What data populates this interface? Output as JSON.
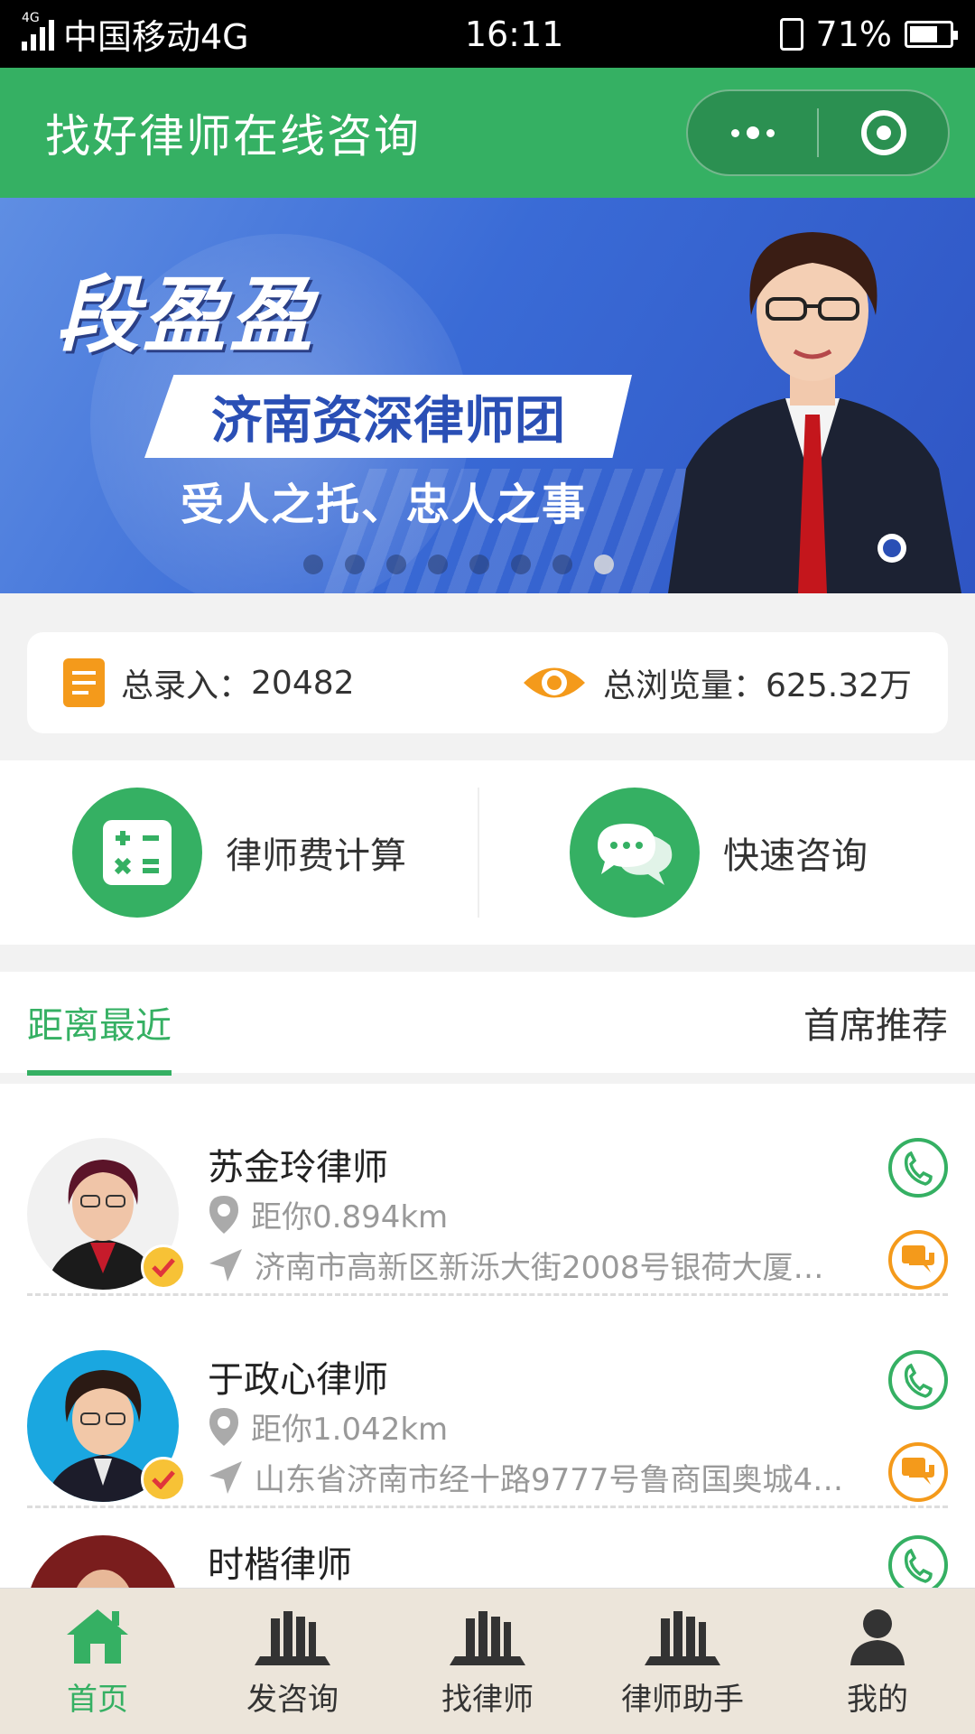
{
  "status_bar": {
    "network_tag": "4G",
    "carrier": "中国移动4G",
    "time": "16:11",
    "battery": "71%",
    "battery_level": 0.71
  },
  "navbar": {
    "title": "找好律师在线咨询"
  },
  "banner": {
    "name": "段盈盈",
    "subtitle": "济南资深律师团",
    "slogan": "受人之托、忠人之事",
    "page_count": 8,
    "active_page": 8
  },
  "stats": {
    "entries_label": "总录入：",
    "entries_value": "20482",
    "views_label": "总浏览量：",
    "views_value": "625.32万"
  },
  "actions": {
    "fee_calc": "律师费计算",
    "quick_consult": "快速咨询"
  },
  "tabs": {
    "nearest": "距离最近",
    "recommended": "首席推荐"
  },
  "lawyers": [
    {
      "name": "苏金玲律师",
      "distance": "距你0.894km",
      "address": "济南市高新区新泺大街2008号银荷大厦…"
    },
    {
      "name": "于政心律师",
      "distance": "距你1.042km",
      "address": "山东省济南市经十路9777号鲁商国奥城4…"
    },
    {
      "name": "时楷律师",
      "distance": "",
      "address": ""
    }
  ],
  "tabbar": {
    "home": "首页",
    "post": "发咨询",
    "find": "找律师",
    "assistant": "律师助手",
    "mine": "我的"
  },
  "colors": {
    "brand_green": "#35b063",
    "accent_orange": "#f49a1b",
    "verify_yellow": "#f7c236",
    "tabbar_bg": "#ece5da"
  }
}
